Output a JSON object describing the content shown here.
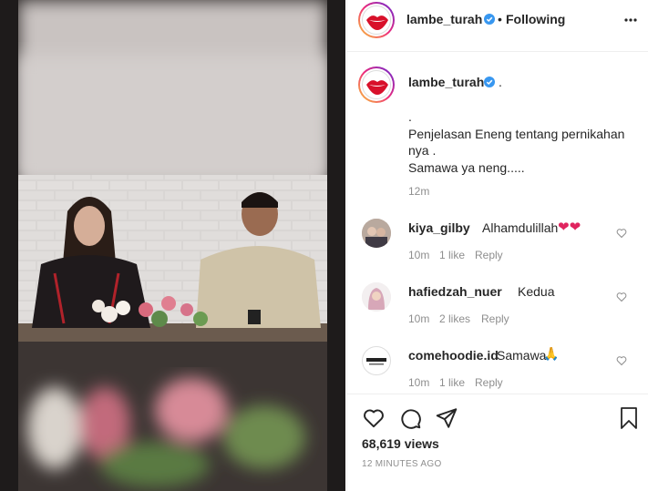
{
  "header": {
    "username": "lambe_turah",
    "separator": "•",
    "follow_status": "Following",
    "more_icon": "more-horizontal-icon"
  },
  "caption": {
    "username": "lambe_turah",
    "suffix": ".",
    "lines": [
      ".",
      "Penjelasan Eneng tentang pernikahan",
      "nya .",
      "Samawa ya neng....."
    ],
    "time": "12m"
  },
  "comments": [
    {
      "username": "kiya_gilby",
      "text": "Alhamdulillah",
      "emoji": "❤❤",
      "time": "10m",
      "likes": "1 like",
      "reply": "Reply"
    },
    {
      "username": "hafiedzah_nuer",
      "text": "Kedua",
      "emoji": "",
      "time": "10m",
      "likes": "2 likes",
      "reply": "Reply"
    },
    {
      "username": "comehoodie.id",
      "text": "Samawa",
      "emoji": "🙏",
      "time": "10m",
      "likes": "1 like",
      "reply": "Reply"
    }
  ],
  "stats": {
    "views": "68,619 views",
    "timestamp": "12 MINUTES AGO"
  },
  "colors": {
    "verified_badge": "#3897f0",
    "emoji_heart": "#e0245e",
    "muted_text": "#8e8e8e"
  }
}
